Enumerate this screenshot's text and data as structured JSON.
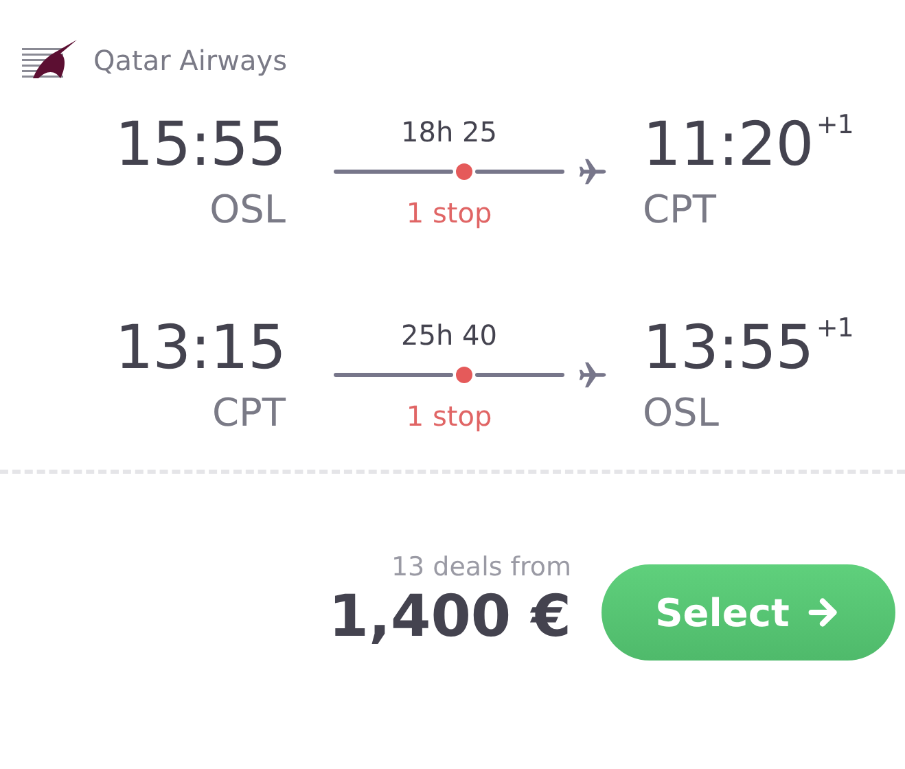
{
  "airline": {
    "name": "Qatar Airways"
  },
  "legs": [
    {
      "departure_time": "15:55",
      "departure_airport": "OSL",
      "duration": "18h 25",
      "stops": "1 stop",
      "arrival_time": "11:20",
      "day_offset": "+1",
      "arrival_airport": "CPT"
    },
    {
      "departure_time": "13:15",
      "departure_airport": "CPT",
      "duration": "25h 40",
      "stops": "1 stop",
      "arrival_time": "13:55",
      "day_offset": "+1",
      "arrival_airport": "OSL"
    }
  ],
  "price": {
    "deals": "13 deals from",
    "amount": "1,400 €"
  },
  "select_button": {
    "label": "Select"
  }
}
